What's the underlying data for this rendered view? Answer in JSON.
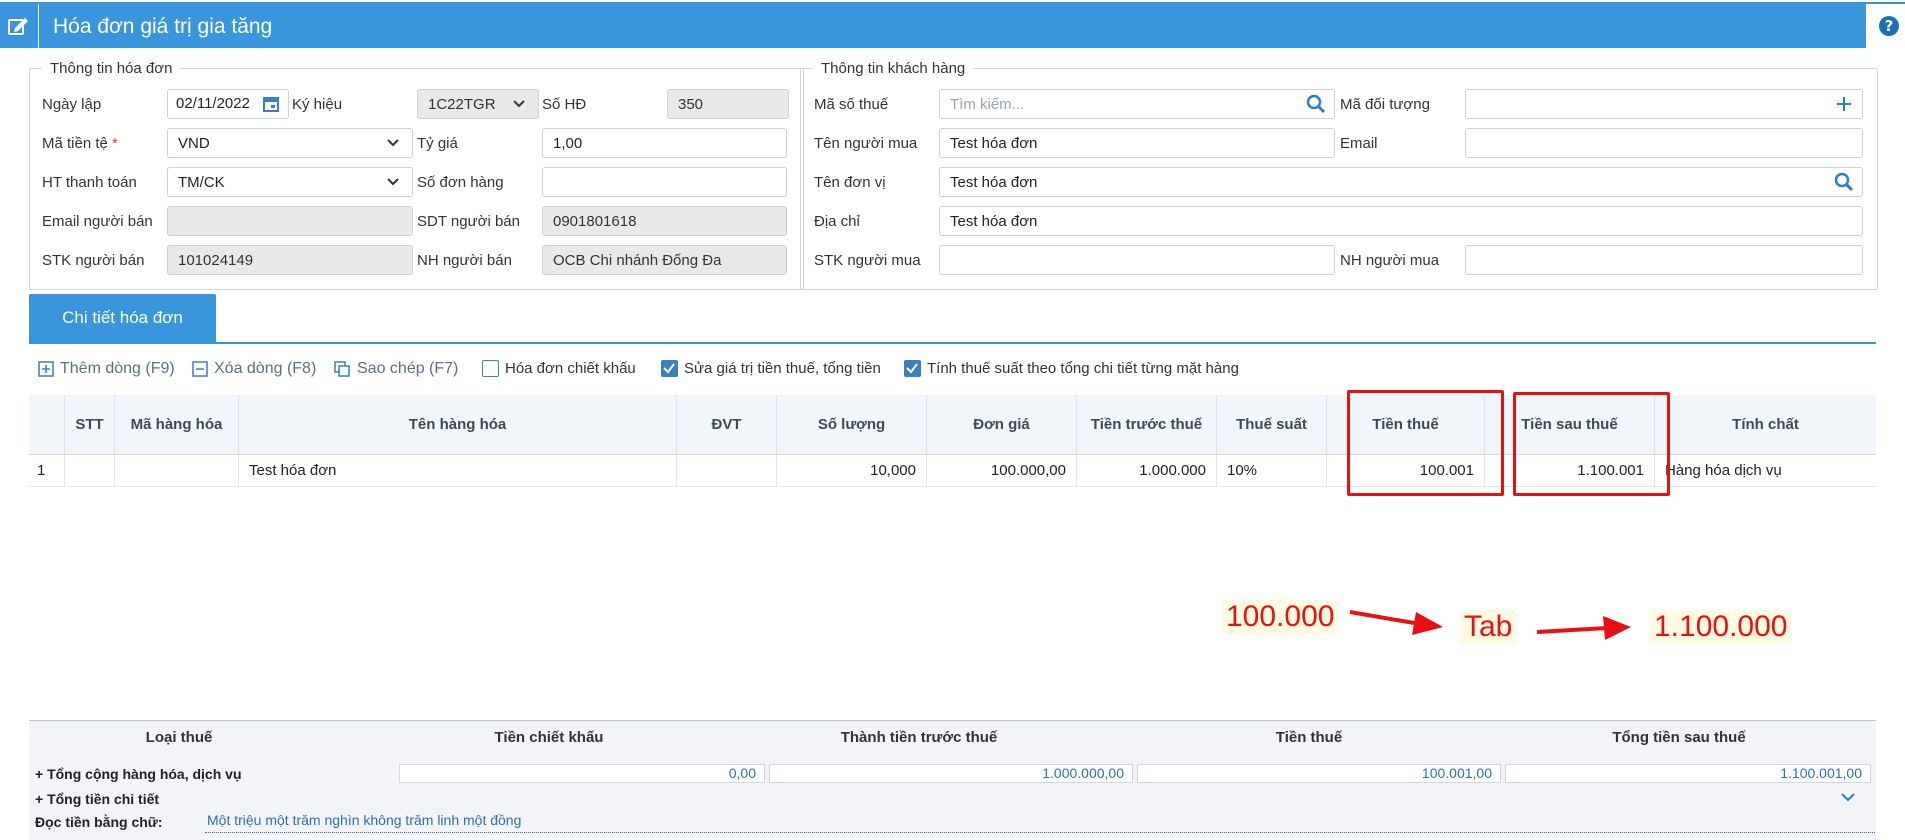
{
  "header": {
    "title": "Hóa đơn giá trị gia tăng"
  },
  "invoice_info": {
    "legend": "Thông tin hóa đơn",
    "date_label": "Ngày lập",
    "date_value": "02/11/2022",
    "symbol_label": "Ký hiệu",
    "symbol_value": "1C22TGR",
    "number_label": "Số HĐ",
    "number_value": "350",
    "currency_label": "Mã tiền tệ",
    "currency_required": "*",
    "currency_value": "VND",
    "rate_label": "Tỷ giá",
    "rate_value": "1,00",
    "payment_label": "HT thanh toán",
    "payment_value": "TM/CK",
    "order_label": "Số đơn hàng",
    "order_value": "",
    "seller_email_label": "Email người bán",
    "seller_email_value": "",
    "seller_phone_label": "SDT người bán",
    "seller_phone_value": "0901801618",
    "seller_account_label": "STK người bán",
    "seller_account_value": "101024149",
    "seller_bank_label": "NH người bán",
    "seller_bank_value": "OCB Chi nhánh Đống Đa"
  },
  "customer_info": {
    "legend": "Thông tin khách hàng",
    "tax_code_label": "Mã số thuế",
    "tax_code_placeholder": "Tìm kiếm...",
    "object_code_label": "Mã đối tượng",
    "object_code_value": "",
    "buyer_name_label": "Tên người mua",
    "buyer_name_value": "Test hóa đơn",
    "email_label": "Email",
    "email_value": "",
    "unit_name_label": "Tên đơn vị",
    "unit_name_value": "Test hóa đơn",
    "address_label": "Địa chỉ",
    "address_value": "Test hóa đơn",
    "buyer_account_label": "STK người mua",
    "buyer_account_value": "",
    "buyer_bank_label": "NH người mua",
    "buyer_bank_value": ""
  },
  "tabs": {
    "detail": "Chi tiết hóa đơn"
  },
  "toolbar": {
    "add_row": "Thêm dòng (F9)",
    "delete_row": "Xóa dòng (F8)",
    "copy": "Sao chép (F7)",
    "discount_invoice": "Hóa đơn chiết khấu",
    "edit_tax_total": "Sửa giá trị tiền thuế, tổng tiền",
    "tax_by_item": "Tính thuế suất theo tổng chi tiết từng mặt hàng"
  },
  "table": {
    "columns": [
      "STT",
      "Mã hàng hóa",
      "Tên hàng hóa",
      "ĐVT",
      "Số lượng",
      "Đơn giá",
      "Tiền trước thuế",
      "Thuế suất",
      "Tiền thuế",
      "Tiền sau thuế",
      "Tính chất"
    ],
    "rows": [
      {
        "index": "1",
        "stt": "",
        "code": "",
        "name": "Test hóa đơn",
        "unit": "",
        "qty": "10,000",
        "price": "100.000,00",
        "pretax": "1.000.000",
        "rate": "10%",
        "tax": "100.001",
        "total": "1.100.001",
        "nature": "Hàng hóa dịch vụ"
      }
    ]
  },
  "annotations": {
    "old_tax": "100.000",
    "tab_key": "Tab",
    "new_total": "1.100.000"
  },
  "summary": {
    "headers": [
      "Loại thuế",
      "Tiền chiết khấu",
      "Thành tiền trước thuế",
      "Tiền thuế",
      "Tổng tiền sau thuế"
    ],
    "goods_label": "+ Tổng cộng hàng hóa, dịch vụ",
    "discount": "0,00",
    "pretax": "1.000.000,00",
    "tax": "100.001,00",
    "total": "1.100.001,00",
    "detail_label": "+ Tổng tiền chi tiết",
    "words_label": "Đọc tiền bằng chữ:",
    "words_value": "Một triệu một trăm nghìn không trăm linh một đồng"
  },
  "colors": {
    "accent": "#3a96dc",
    "highlight": "#e81010"
  }
}
